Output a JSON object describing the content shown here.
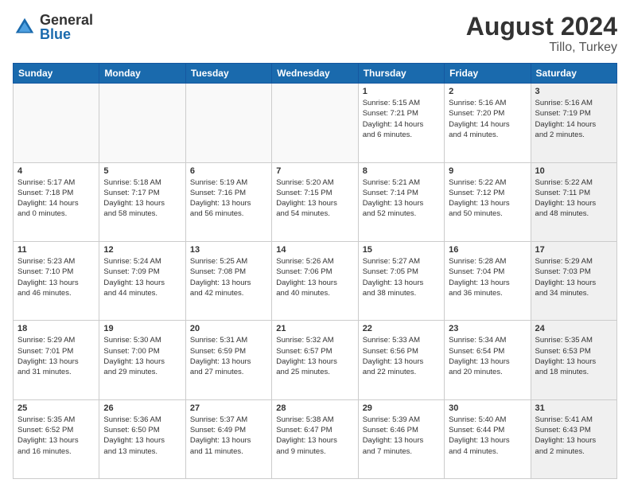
{
  "header": {
    "logo_general": "General",
    "logo_blue": "Blue",
    "month_year": "August 2024",
    "location": "Tillo, Turkey"
  },
  "days_of_week": [
    "Sunday",
    "Monday",
    "Tuesday",
    "Wednesday",
    "Thursday",
    "Friday",
    "Saturday"
  ],
  "weeks": [
    [
      {
        "day": "",
        "info": "",
        "shaded": false,
        "empty": true
      },
      {
        "day": "",
        "info": "",
        "shaded": false,
        "empty": true
      },
      {
        "day": "",
        "info": "",
        "shaded": false,
        "empty": true
      },
      {
        "day": "",
        "info": "",
        "shaded": false,
        "empty": true
      },
      {
        "day": "1",
        "info": "Sunrise: 5:15 AM\nSunset: 7:21 PM\nDaylight: 14 hours\nand 6 minutes.",
        "shaded": false,
        "empty": false
      },
      {
        "day": "2",
        "info": "Sunrise: 5:16 AM\nSunset: 7:20 PM\nDaylight: 14 hours\nand 4 minutes.",
        "shaded": false,
        "empty": false
      },
      {
        "day": "3",
        "info": "Sunrise: 5:16 AM\nSunset: 7:19 PM\nDaylight: 14 hours\nand 2 minutes.",
        "shaded": true,
        "empty": false
      }
    ],
    [
      {
        "day": "4",
        "info": "Sunrise: 5:17 AM\nSunset: 7:18 PM\nDaylight: 14 hours\nand 0 minutes.",
        "shaded": false,
        "empty": false
      },
      {
        "day": "5",
        "info": "Sunrise: 5:18 AM\nSunset: 7:17 PM\nDaylight: 13 hours\nand 58 minutes.",
        "shaded": false,
        "empty": false
      },
      {
        "day": "6",
        "info": "Sunrise: 5:19 AM\nSunset: 7:16 PM\nDaylight: 13 hours\nand 56 minutes.",
        "shaded": false,
        "empty": false
      },
      {
        "day": "7",
        "info": "Sunrise: 5:20 AM\nSunset: 7:15 PM\nDaylight: 13 hours\nand 54 minutes.",
        "shaded": false,
        "empty": false
      },
      {
        "day": "8",
        "info": "Sunrise: 5:21 AM\nSunset: 7:14 PM\nDaylight: 13 hours\nand 52 minutes.",
        "shaded": false,
        "empty": false
      },
      {
        "day": "9",
        "info": "Sunrise: 5:22 AM\nSunset: 7:12 PM\nDaylight: 13 hours\nand 50 minutes.",
        "shaded": false,
        "empty": false
      },
      {
        "day": "10",
        "info": "Sunrise: 5:22 AM\nSunset: 7:11 PM\nDaylight: 13 hours\nand 48 minutes.",
        "shaded": true,
        "empty": false
      }
    ],
    [
      {
        "day": "11",
        "info": "Sunrise: 5:23 AM\nSunset: 7:10 PM\nDaylight: 13 hours\nand 46 minutes.",
        "shaded": false,
        "empty": false
      },
      {
        "day": "12",
        "info": "Sunrise: 5:24 AM\nSunset: 7:09 PM\nDaylight: 13 hours\nand 44 minutes.",
        "shaded": false,
        "empty": false
      },
      {
        "day": "13",
        "info": "Sunrise: 5:25 AM\nSunset: 7:08 PM\nDaylight: 13 hours\nand 42 minutes.",
        "shaded": false,
        "empty": false
      },
      {
        "day": "14",
        "info": "Sunrise: 5:26 AM\nSunset: 7:06 PM\nDaylight: 13 hours\nand 40 minutes.",
        "shaded": false,
        "empty": false
      },
      {
        "day": "15",
        "info": "Sunrise: 5:27 AM\nSunset: 7:05 PM\nDaylight: 13 hours\nand 38 minutes.",
        "shaded": false,
        "empty": false
      },
      {
        "day": "16",
        "info": "Sunrise: 5:28 AM\nSunset: 7:04 PM\nDaylight: 13 hours\nand 36 minutes.",
        "shaded": false,
        "empty": false
      },
      {
        "day": "17",
        "info": "Sunrise: 5:29 AM\nSunset: 7:03 PM\nDaylight: 13 hours\nand 34 minutes.",
        "shaded": true,
        "empty": false
      }
    ],
    [
      {
        "day": "18",
        "info": "Sunrise: 5:29 AM\nSunset: 7:01 PM\nDaylight: 13 hours\nand 31 minutes.",
        "shaded": false,
        "empty": false
      },
      {
        "day": "19",
        "info": "Sunrise: 5:30 AM\nSunset: 7:00 PM\nDaylight: 13 hours\nand 29 minutes.",
        "shaded": false,
        "empty": false
      },
      {
        "day": "20",
        "info": "Sunrise: 5:31 AM\nSunset: 6:59 PM\nDaylight: 13 hours\nand 27 minutes.",
        "shaded": false,
        "empty": false
      },
      {
        "day": "21",
        "info": "Sunrise: 5:32 AM\nSunset: 6:57 PM\nDaylight: 13 hours\nand 25 minutes.",
        "shaded": false,
        "empty": false
      },
      {
        "day": "22",
        "info": "Sunrise: 5:33 AM\nSunset: 6:56 PM\nDaylight: 13 hours\nand 22 minutes.",
        "shaded": false,
        "empty": false
      },
      {
        "day": "23",
        "info": "Sunrise: 5:34 AM\nSunset: 6:54 PM\nDaylight: 13 hours\nand 20 minutes.",
        "shaded": false,
        "empty": false
      },
      {
        "day": "24",
        "info": "Sunrise: 5:35 AM\nSunset: 6:53 PM\nDaylight: 13 hours\nand 18 minutes.",
        "shaded": true,
        "empty": false
      }
    ],
    [
      {
        "day": "25",
        "info": "Sunrise: 5:35 AM\nSunset: 6:52 PM\nDaylight: 13 hours\nand 16 minutes.",
        "shaded": false,
        "empty": false
      },
      {
        "day": "26",
        "info": "Sunrise: 5:36 AM\nSunset: 6:50 PM\nDaylight: 13 hours\nand 13 minutes.",
        "shaded": false,
        "empty": false
      },
      {
        "day": "27",
        "info": "Sunrise: 5:37 AM\nSunset: 6:49 PM\nDaylight: 13 hours\nand 11 minutes.",
        "shaded": false,
        "empty": false
      },
      {
        "day": "28",
        "info": "Sunrise: 5:38 AM\nSunset: 6:47 PM\nDaylight: 13 hours\nand 9 minutes.",
        "shaded": false,
        "empty": false
      },
      {
        "day": "29",
        "info": "Sunrise: 5:39 AM\nSunset: 6:46 PM\nDaylight: 13 hours\nand 7 minutes.",
        "shaded": false,
        "empty": false
      },
      {
        "day": "30",
        "info": "Sunrise: 5:40 AM\nSunset: 6:44 PM\nDaylight: 13 hours\nand 4 minutes.",
        "shaded": false,
        "empty": false
      },
      {
        "day": "31",
        "info": "Sunrise: 5:41 AM\nSunset: 6:43 PM\nDaylight: 13 hours\nand 2 minutes.",
        "shaded": true,
        "empty": false
      }
    ]
  ]
}
